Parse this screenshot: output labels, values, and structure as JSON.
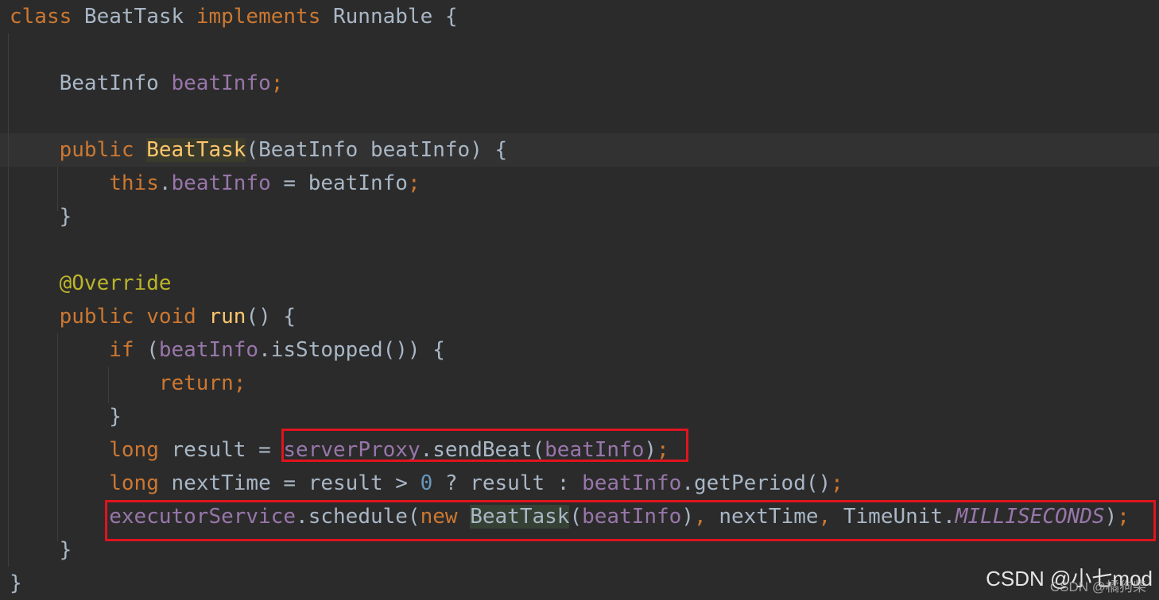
{
  "code": {
    "lines": [
      [
        {
          "t": "class ",
          "c": "kw"
        },
        {
          "t": "BeatTask "
        },
        {
          "t": "implements ",
          "c": "kw"
        },
        {
          "t": "Runnable {"
        }
      ],
      [],
      [
        {
          "t": "    BeatInfo "
        },
        {
          "t": "beatInfo",
          "c": "fld"
        },
        {
          "t": ";",
          "c": "kw"
        }
      ],
      [],
      [
        {
          "t": "    "
        },
        {
          "t": "public ",
          "c": "kw"
        },
        {
          "t": "BeatTask",
          "c": "fn hl-y"
        },
        {
          "t": "(BeatInfo beatInfo) {"
        }
      ],
      [
        {
          "t": "        "
        },
        {
          "t": "this",
          "c": "kw"
        },
        {
          "t": "."
        },
        {
          "t": "beatInfo",
          "c": "fld"
        },
        {
          "t": " = beatInfo"
        },
        {
          "t": ";",
          "c": "kw"
        }
      ],
      [
        {
          "t": "    }"
        }
      ],
      [],
      [
        {
          "t": "    "
        },
        {
          "t": "@Override",
          "c": "ann"
        }
      ],
      [
        {
          "t": "    "
        },
        {
          "t": "public void ",
          "c": "kw"
        },
        {
          "t": "run",
          "c": "fn"
        },
        {
          "t": "() {"
        }
      ],
      [
        {
          "t": "        "
        },
        {
          "t": "if ",
          "c": "kw"
        },
        {
          "t": "("
        },
        {
          "t": "beatInfo",
          "c": "fld"
        },
        {
          "t": ".isStopped()) {"
        }
      ],
      [
        {
          "t": "            "
        },
        {
          "t": "return;",
          "c": "kw"
        }
      ],
      [
        {
          "t": "        }"
        }
      ],
      [
        {
          "t": "        "
        },
        {
          "t": "long ",
          "c": "kw"
        },
        {
          "t": "result = "
        },
        {
          "t": "serverProxy",
          "c": "fld"
        },
        {
          "t": ".sendBeat("
        },
        {
          "t": "beatInfo",
          "c": "fld"
        },
        {
          "t": ")"
        },
        {
          "t": ";",
          "c": "kw"
        }
      ],
      [
        {
          "t": "        "
        },
        {
          "t": "long ",
          "c": "kw"
        },
        {
          "t": "nextTime = result > "
        },
        {
          "t": "0",
          "c": "num"
        },
        {
          "t": " ? result : "
        },
        {
          "t": "beatInfo",
          "c": "fld"
        },
        {
          "t": ".getPeriod()"
        },
        {
          "t": ";",
          "c": "kw"
        }
      ],
      [
        {
          "t": "        "
        },
        {
          "t": "executorService",
          "c": "fld"
        },
        {
          "t": ".schedule("
        },
        {
          "t": "new ",
          "c": "kw"
        },
        {
          "t": "BeatTask",
          "c": "hl"
        },
        {
          "t": "("
        },
        {
          "t": "beatInfo",
          "c": "fld"
        },
        {
          "t": ")"
        },
        {
          "t": ", ",
          "c": "kw"
        },
        {
          "t": "nextTime"
        },
        {
          "t": ", ",
          "c": "kw"
        },
        {
          "t": "TimeUnit."
        },
        {
          "t": "MILLISECONDS",
          "c": "fld-i"
        },
        {
          "t": ")"
        },
        {
          "t": ";",
          "c": "kw"
        }
      ],
      [
        {
          "t": "    }"
        }
      ],
      [
        {
          "t": "}"
        }
      ]
    ]
  },
  "watermark": {
    "primary": "CSDN @小七mod",
    "secondary": "CSDN @橘狗柴"
  }
}
